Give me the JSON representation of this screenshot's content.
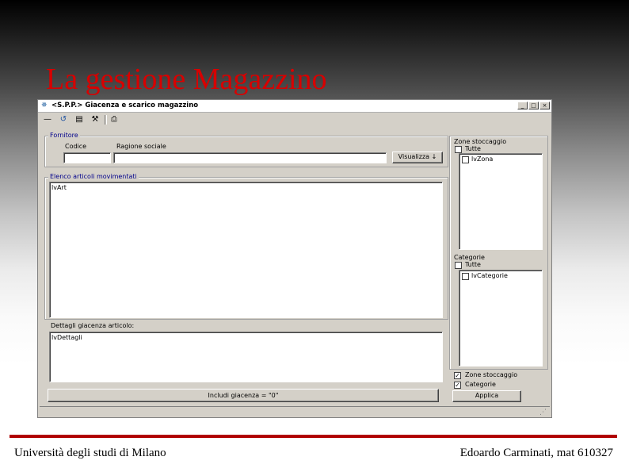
{
  "slide": {
    "title": "La gestione Magazzino",
    "footer_left": "Università degli studi di Milano",
    "footer_right": "Edoardo Carminati, mat 610327"
  },
  "window": {
    "title": "<S.P.P.> Giacenza e scarico magazzino",
    "min_label": "_",
    "max_label": "□",
    "close_label": "×"
  },
  "toolbar": {
    "icons": [
      "new-icon",
      "refresh-icon",
      "save-icon",
      "tools-icon",
      "print-icon"
    ]
  },
  "fornitore": {
    "group_label": "Fornitore",
    "codice_label": "Codice",
    "codice_value": "",
    "ragione_label": "Ragione sociale",
    "ragione_value": "",
    "visualizza_label": "Visualizza ↓"
  },
  "articoli": {
    "group_label": "Elenco articoli movimentati",
    "list_value": "lvArt"
  },
  "dettagli": {
    "label": "Dettagli giacenza articolo:",
    "list_value": "lvDettagli"
  },
  "includi_button": "Includi giacenza = \"0\"",
  "zone": {
    "label": "Zone stoccaggio",
    "tutte_label": "Tutte",
    "tutte_checked": false,
    "list_item": "lvZona",
    "list_item_checked": false
  },
  "categorie": {
    "label": "Categorie",
    "tutte_label": "Tutte",
    "tutte_checked": false,
    "list_item": "lvCategorie",
    "list_item_checked": false
  },
  "filters": {
    "zone_label": "Zone stoccaggio",
    "zone_checked": true,
    "categorie_label": "Categorie",
    "categorie_checked": true
  },
  "applica_button": "Applica",
  "colors": {
    "title_red": "#d80000",
    "footer_rule": "#b00000",
    "window_face": "#d4d0c8",
    "group_label_blue": "#00008b"
  }
}
